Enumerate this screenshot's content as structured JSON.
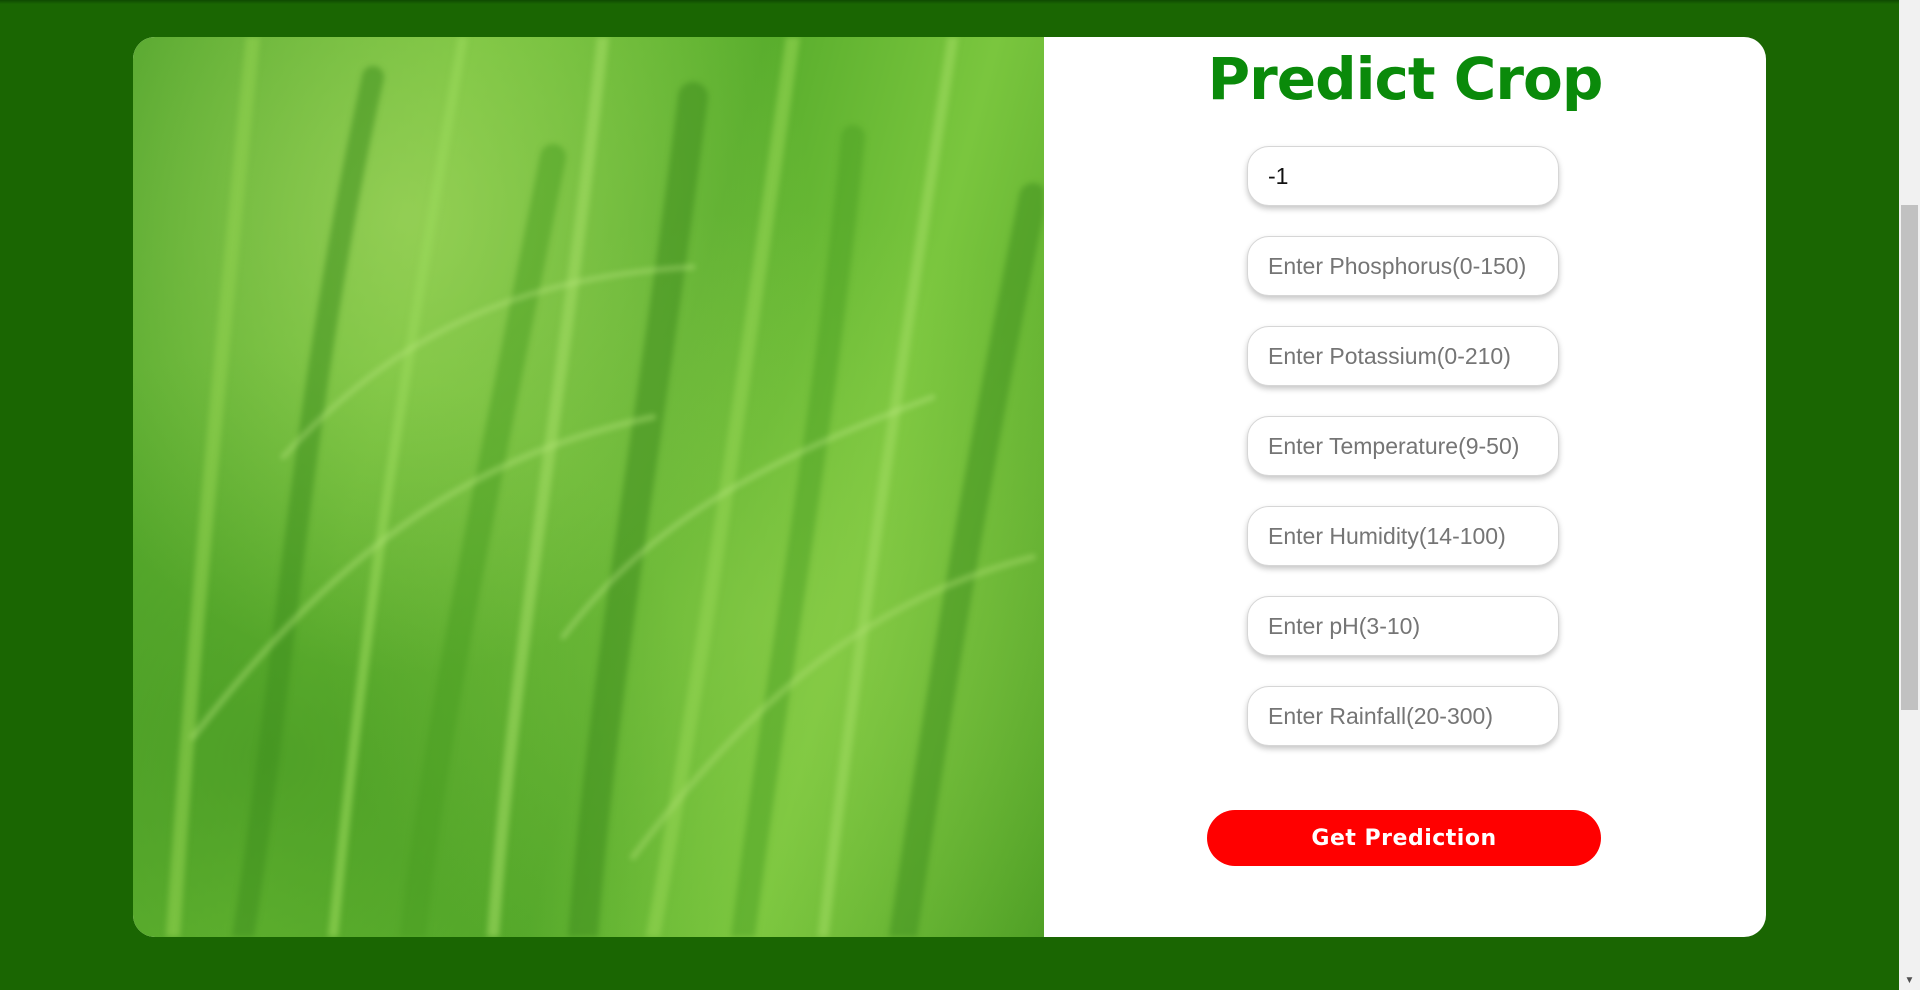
{
  "title": "Predict Crop",
  "fields": [
    {
      "name": "nitrogen",
      "value": "-1",
      "placeholder": ""
    },
    {
      "name": "phosphorus",
      "value": "",
      "placeholder": "Enter Phosphorus(0-150)"
    },
    {
      "name": "potassium",
      "value": "",
      "placeholder": "Enter Potassium(0-210)"
    },
    {
      "name": "temperature",
      "value": "",
      "placeholder": "Enter Temperature(9-50)"
    },
    {
      "name": "humidity",
      "value": "",
      "placeholder": "Enter Humidity(14-100)"
    },
    {
      "name": "ph",
      "value": "",
      "placeholder": "Enter pH(3-10)"
    },
    {
      "name": "rainfall",
      "value": "",
      "placeholder": "Enter Rainfall(20-300)"
    }
  ],
  "button": {
    "label": "Get Prediction"
  },
  "colors": {
    "background": "#1a6602",
    "title": "#0a8a0a",
    "button": "#ff0000",
    "card": "#ffffff"
  },
  "icons": {
    "scroll_arrow": "chevron-down-icon"
  }
}
